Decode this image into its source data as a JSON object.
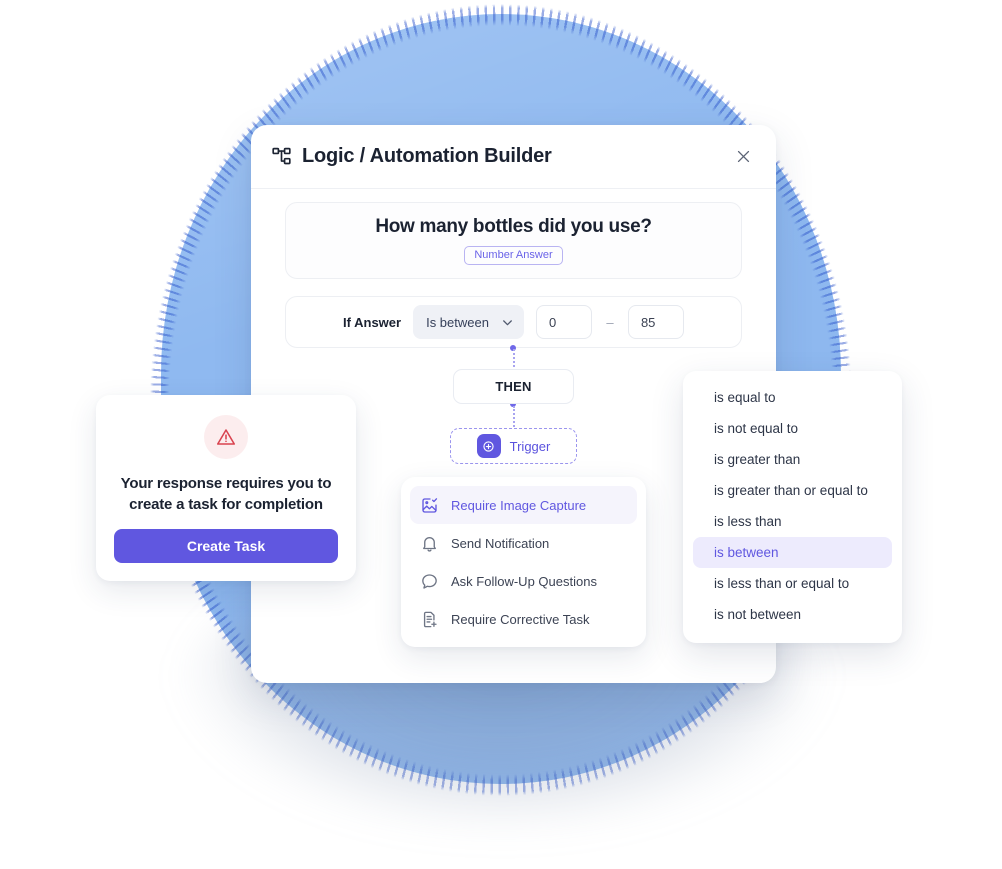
{
  "background": {
    "dome_color": "#8FB9F0",
    "dome_edge_noise_color": "#2850C8"
  },
  "modal": {
    "icon": "hierarchy-icon",
    "title": "Logic / Automation Builder",
    "close_icon": "close-icon",
    "question": {
      "text": "How many bottles did you use?",
      "answer_type_badge": "Number Answer",
      "badge_color": "#6A63E8"
    },
    "condition": {
      "label": "If Answer",
      "operator_value": "Is between",
      "chevron_icon": "chevron-down-icon",
      "min_value": "0",
      "range_separator": "–",
      "max_value": "85"
    },
    "then_label": "THEN",
    "trigger": {
      "icon": "plus-circle-icon",
      "label": "Trigger",
      "accent": "#6057E0"
    }
  },
  "actions_menu": {
    "items": [
      {
        "icon": "image-check-icon",
        "label": "Require Image Capture",
        "selected": true
      },
      {
        "icon": "bell-icon",
        "label": "Send Notification",
        "selected": false
      },
      {
        "icon": "chat-bubble-icon",
        "label": "Ask Follow-Up Questions",
        "selected": false
      },
      {
        "icon": "document-plus-icon",
        "label": "Require Corrective Task",
        "selected": false
      }
    ],
    "selected_color": "#6057E0",
    "selected_background": "#F5F4FC"
  },
  "operator_menu": {
    "items": [
      {
        "label": "is equal to",
        "selected": false
      },
      {
        "label": "is not equal to",
        "selected": false
      },
      {
        "label": "is greater than",
        "selected": false
      },
      {
        "label": "is greater than or equal to",
        "selected": false
      },
      {
        "label": "is less than",
        "selected": false
      },
      {
        "label": "is between",
        "selected": true
      },
      {
        "label": "is less than or equal to",
        "selected": false
      },
      {
        "label": "is not between",
        "selected": false
      }
    ],
    "selected_color": "#6057E0",
    "selected_background": "#EDEBFD"
  },
  "warning_card": {
    "icon": "warning-triangle-icon",
    "icon_color": "#D9434F",
    "icon_background": "#FCEDEE",
    "message": "Your response requires you to\ncreate  a task for completion",
    "button_label": "Create Task",
    "button_color": "#6057E0"
  }
}
